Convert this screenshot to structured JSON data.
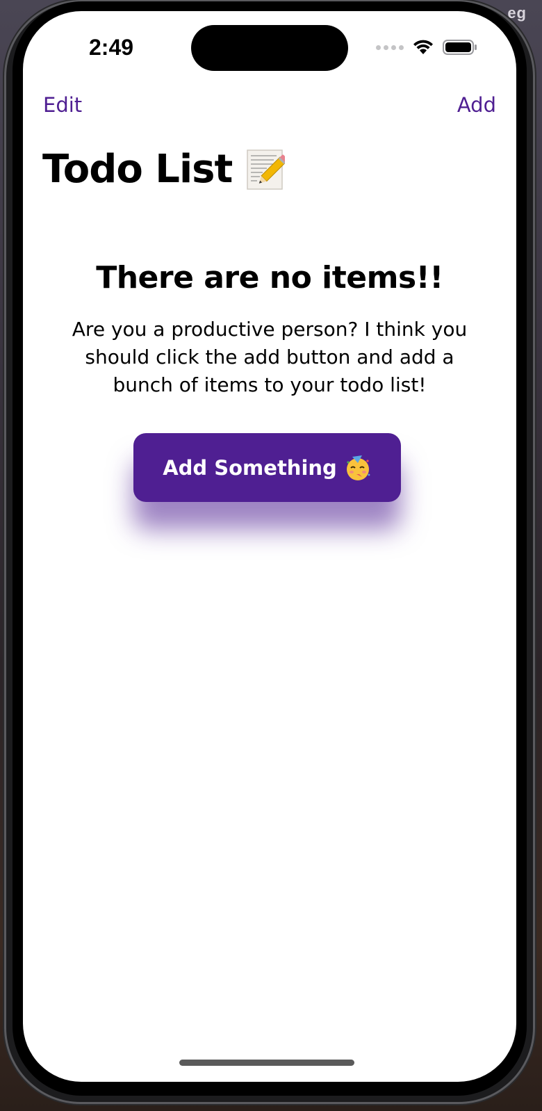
{
  "status_bar": {
    "time": "2:49"
  },
  "desktop": {
    "corner_label": "eg"
  },
  "nav_bar": {
    "edit_label": "Edit",
    "add_label": "Add",
    "title": "Todo List",
    "title_icon": "memo-icon"
  },
  "empty_state": {
    "heading": "There are no items!!",
    "message": "Are you a productive person? I think you should click the add button and add a bunch of items to your todo list!",
    "button_label": "Add Something",
    "button_icon": "partying-face-icon"
  },
  "colors": {
    "accent": "#4f1f92",
    "background": "#ffffff",
    "text": "#000000"
  }
}
